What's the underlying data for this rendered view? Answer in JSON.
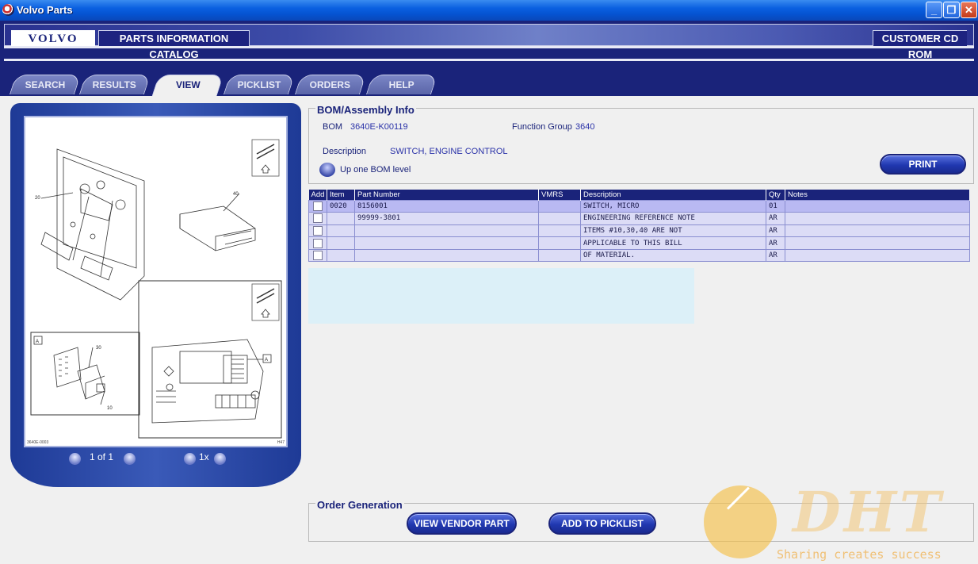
{
  "window": {
    "title": "Volvo Parts",
    "controls": [
      "_",
      "❐",
      "✕"
    ]
  },
  "header": {
    "logo": "VOLVO",
    "catalog_title": "PARTS INFORMATION CATALOG",
    "cd_label": "CUSTOMER CD ROM"
  },
  "tabs": [
    {
      "label": "SEARCH",
      "active": false
    },
    {
      "label": "RESULTS",
      "active": false
    },
    {
      "label": "VIEW",
      "active": true
    },
    {
      "label": "PICKLIST",
      "active": false
    },
    {
      "label": "ORDERS",
      "active": false
    },
    {
      "label": "HELP",
      "active": false
    }
  ],
  "viewer": {
    "page_indicator": "1 of 1",
    "zoom": "1x",
    "drawing_number": "3640E-0003",
    "drawing_code": "H47",
    "callouts": [
      "20",
      "40",
      "30",
      "10"
    ]
  },
  "bom": {
    "legend": "BOM/Assembly Info",
    "bom_label": "BOM",
    "bom_value": "3640E-K00119",
    "function_group_label": "Function Group",
    "function_group_value": "3640",
    "description_label": "Description",
    "description_value": "SWITCH, ENGINE CONTROL",
    "up_level_label": "Up one BOM level",
    "print_label": "PRINT"
  },
  "parts_table": {
    "columns": [
      "Add",
      "Item",
      "Part Number",
      "VMRS",
      "Description",
      "Qty",
      "Notes"
    ],
    "rows": [
      {
        "item": "0020",
        "part_number": "8156001",
        "vmrs": "",
        "description": "SWITCH, MICRO",
        "qty": "01",
        "notes": "",
        "selected": true
      },
      {
        "item": "",
        "part_number": "99999-3801",
        "vmrs": "",
        "description": "ENGINEERING REFERENCE NOTE",
        "qty": "AR",
        "notes": "",
        "selected": false
      },
      {
        "item": "",
        "part_number": "",
        "vmrs": "",
        "description": "ITEMS #10,30,40 ARE NOT",
        "qty": "AR",
        "notes": "",
        "selected": false
      },
      {
        "item": "",
        "part_number": "",
        "vmrs": "",
        "description": "APPLICABLE TO THIS BILL",
        "qty": "AR",
        "notes": "",
        "selected": false
      },
      {
        "item": "",
        "part_number": "",
        "vmrs": "",
        "description": "OF MATERIAL.",
        "qty": "AR",
        "notes": "",
        "selected": false
      }
    ]
  },
  "order_generation": {
    "legend": "Order Generation",
    "view_vendor_label": "VIEW VENDOR PART",
    "add_picklist_label": "ADD TO PICKLIST"
  },
  "watermark": {
    "logo": "DHT",
    "tagline": "Sharing creates success"
  },
  "colors": {
    "navy": "#1a237a",
    "accent": "#2a32a8",
    "row_selected": "#b9b9f2",
    "row": "#dcdcf6"
  }
}
